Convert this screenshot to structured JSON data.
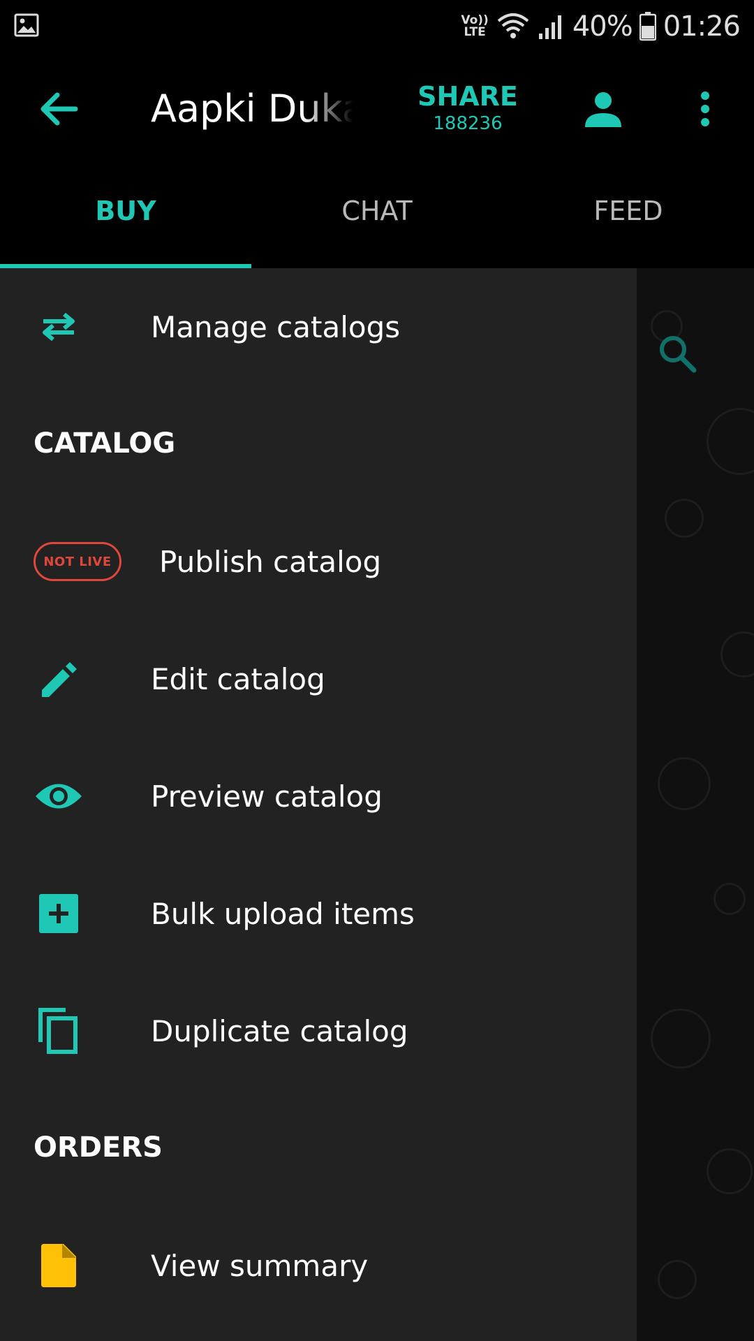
{
  "status_bar": {
    "volte_top": "Vo))",
    "volte_bottom": "LTE",
    "battery": "40%",
    "time": "01:26"
  },
  "app_bar": {
    "title": "Aapki Dukaan",
    "share_label": "SHARE",
    "share_code": "188236"
  },
  "tabs": [
    {
      "label": "BUY",
      "active": true
    },
    {
      "label": "CHAT",
      "active": false
    },
    {
      "label": "FEED",
      "active": false
    }
  ],
  "drawer": {
    "manage_catalogs": "Manage catalogs",
    "catalog_section": "CATALOG",
    "not_live_badge": "NOT LIVE",
    "publish_catalog": "Publish catalog",
    "edit_catalog": "Edit catalog",
    "preview_catalog": "Preview catalog",
    "bulk_upload_items": "Bulk upload items",
    "duplicate_catalog": "Duplicate catalog",
    "orders_section": "ORDERS",
    "view_summary": "View summary"
  },
  "colors": {
    "accent": "#1fc8b4",
    "drawer_bg": "#222222",
    "badge_red": "#e0473c",
    "summary_icon": "#ffc107"
  },
  "icons": [
    "gallery-icon",
    "wifi-icon",
    "signal-icon",
    "battery-icon",
    "back-arrow-icon",
    "profile-icon",
    "more-vert-icon",
    "search-icon",
    "swap-icon",
    "pencil-icon",
    "eye-icon",
    "add-box-icon",
    "copy-icon",
    "document-icon"
  ]
}
